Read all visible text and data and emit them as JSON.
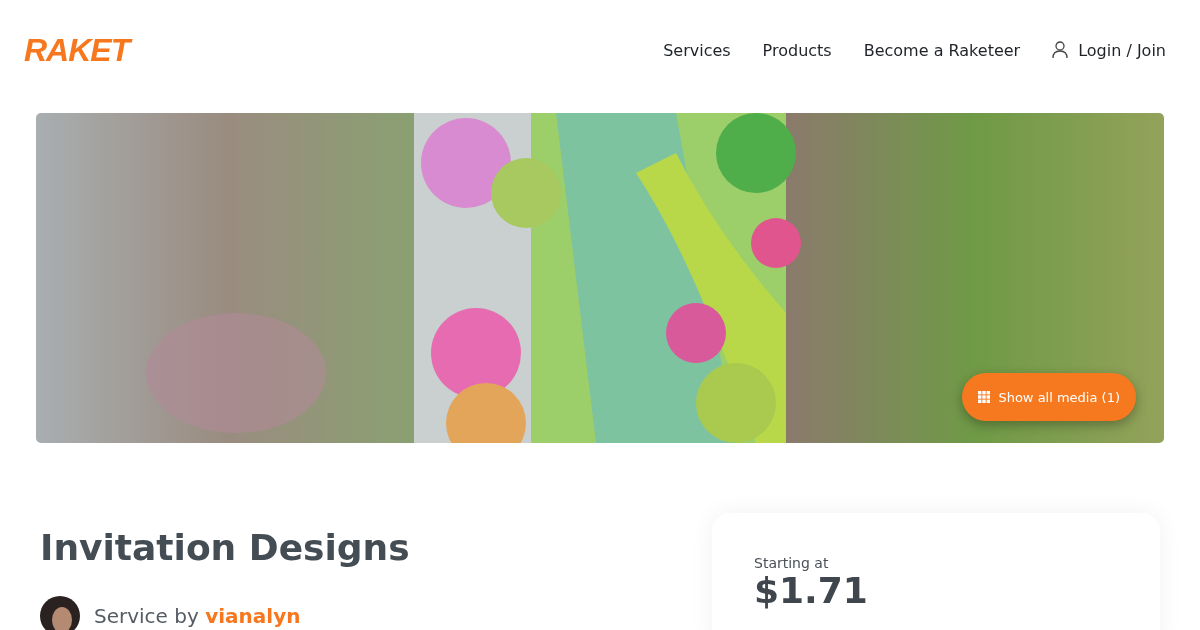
{
  "header": {
    "logo": "RAKET",
    "nav": [
      {
        "label": "Services"
      },
      {
        "label": "Products"
      },
      {
        "label": "Become a Raketeer"
      }
    ],
    "login": "Login / Join"
  },
  "hero": {
    "kind": "picture",
    "button": "Show all media (1)"
  },
  "service": {
    "title": "Invitation Designs",
    "by": "Service by",
    "seller": "vianalyn"
  },
  "pricing": {
    "label": "Starting at",
    "price": "$1.71"
  }
}
